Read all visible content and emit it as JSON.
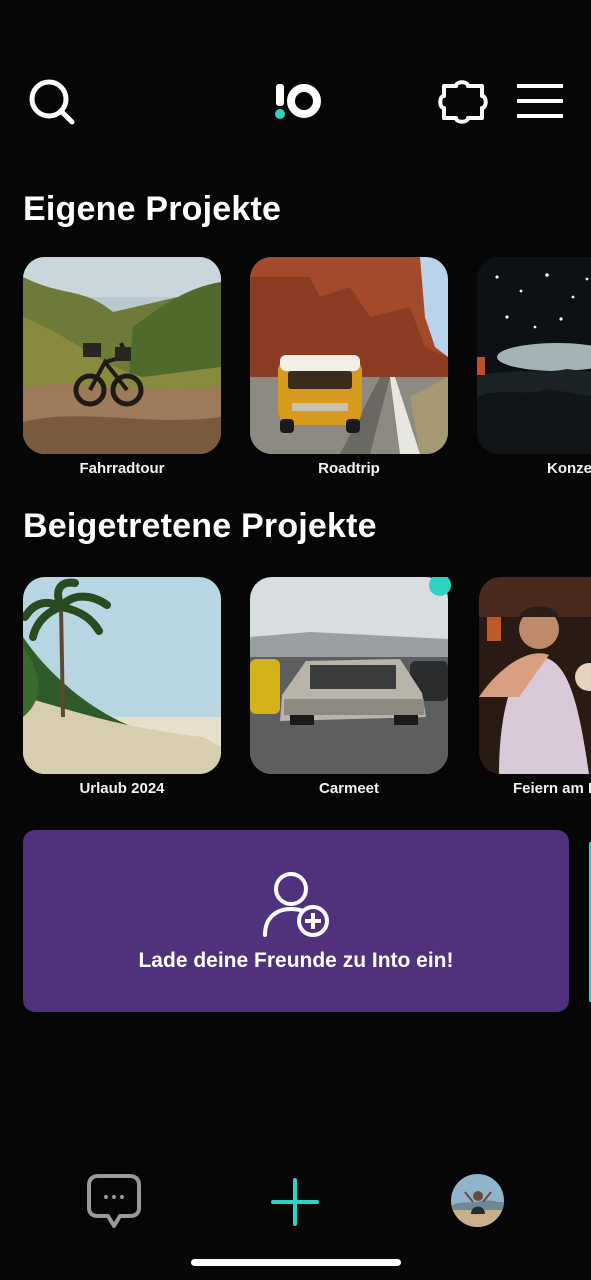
{
  "header": {
    "logo_text": "!o",
    "icons": [
      "search-icon",
      "puzzle-icon",
      "menu-icon"
    ]
  },
  "own_projects": {
    "title": "Eigene Projekte",
    "items": [
      {
        "label": "Fahrradtour",
        "image": "bicycle-in-valley"
      },
      {
        "label": "Roadtrip",
        "image": "van-on-desert-road"
      },
      {
        "label": "Konze",
        "image": "concert-crowd"
      }
    ]
  },
  "joined_projects": {
    "title": "Beigetretene Projekte",
    "items": [
      {
        "label": "Urlaub 2024",
        "image": "palm-beach"
      },
      {
        "label": "Carmeet",
        "image": "cars-parking-lot",
        "has_new_badge": true
      },
      {
        "label": "Feiern am I",
        "image": "party-people"
      }
    ]
  },
  "invite": {
    "text": "Lade deine Freunde zu Into ein!",
    "icon": "add-user-icon"
  },
  "bottom_nav": {
    "icons": [
      "chat-icon",
      "plus-icon",
      "profile-avatar"
    ]
  },
  "colors": {
    "background": "#060606",
    "accent": "#2fd3c3",
    "invite_bg": "#50317c",
    "text": "#ffffff"
  }
}
